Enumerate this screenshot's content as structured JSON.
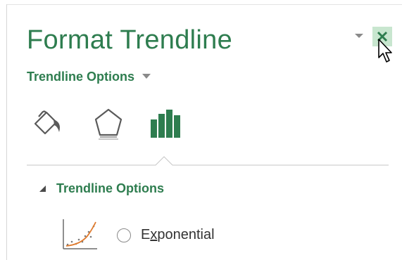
{
  "pane": {
    "title": "Format Trendline",
    "section_dropdown_label": "Trendline Options",
    "subsection_label": "Trendline Options",
    "option_label_first": "E",
    "option_label_accel": "x",
    "option_label_rest": "ponential",
    "option_selected": false
  },
  "tabs": [
    {
      "name": "fill-line",
      "icon": "paint-bucket-icon"
    },
    {
      "name": "effects",
      "icon": "pentagon-icon"
    },
    {
      "name": "trendline-options",
      "icon": "bar-chart-icon",
      "active": true
    }
  ],
  "colors": {
    "accent": "#2e7d4f",
    "close_bg": "#c8e6cf",
    "text": "#333333",
    "divider": "#c6c6c6"
  }
}
